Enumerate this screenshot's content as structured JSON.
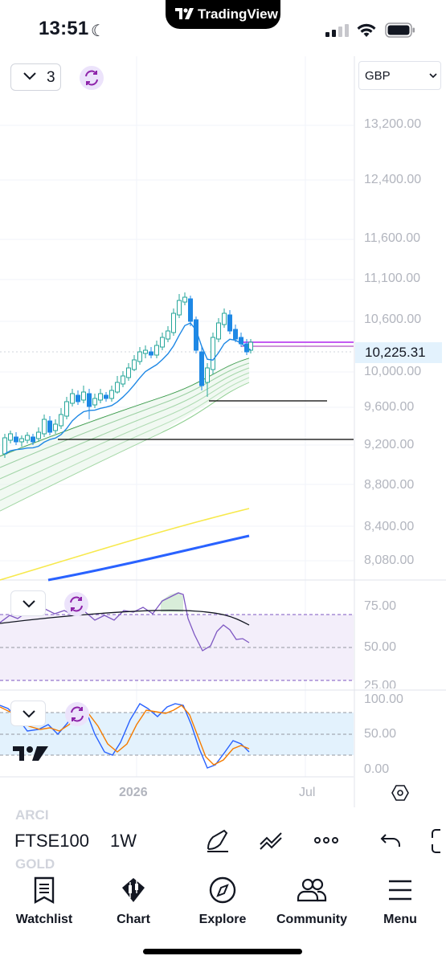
{
  "status_bar": {
    "time": "13:51",
    "brand": "TradingView"
  },
  "chart": {
    "interval_count": "3",
    "currency": "GBP",
    "price_axis": [
      "13,200.00",
      "12,400.00",
      "11,600.00",
      "11,100.00",
      "10,600.00",
      "10,000.00",
      "9,600.00",
      "9,200.00",
      "8,800.00",
      "8,400.00",
      "8,080.00"
    ],
    "current_price": "10,225.31",
    "rsi_axis": [
      "75.00",
      "50.00",
      "25.00"
    ],
    "stoch_axis": [
      "100.00",
      "50.00",
      "0.00"
    ],
    "time_axis": [
      "2026",
      "Jul"
    ],
    "colors": {
      "up": "#26a69a",
      "down": "#1e88e5",
      "rsi": "#7e57c2",
      "current_price_line": "#c45bf2",
      "sma_yellow": "#f7e94d",
      "sma_blue": "#2962ff",
      "stoch_k": "#2962ff",
      "stoch_d": "#f57c00"
    }
  },
  "symbol_bar": {
    "ghost_top": "ARCI",
    "symbol": "FTSE100",
    "interval": "1W",
    "ghost_bottom": "GOLD"
  },
  "tabs": [
    {
      "label": "Watchlist",
      "icon": "watchlist-icon"
    },
    {
      "label": "Chart",
      "icon": "chart-icon"
    },
    {
      "label": "Explore",
      "icon": "compass-icon"
    },
    {
      "label": "Community",
      "icon": "community-icon"
    },
    {
      "label": "Menu",
      "icon": "menu-icon"
    }
  ]
}
